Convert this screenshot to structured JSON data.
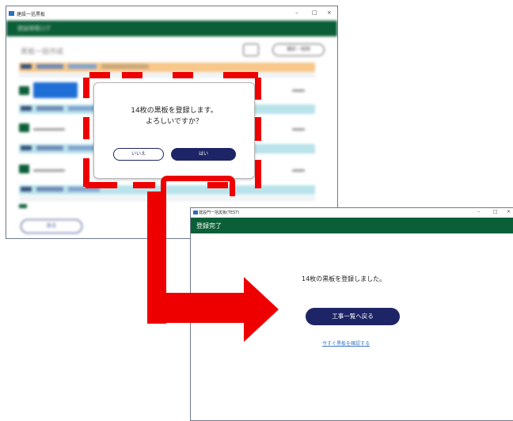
{
  "window1": {
    "title": "建設一括黒板",
    "minimize": "–",
    "maximize": "□",
    "close": "×",
    "header": "建設現場ログ",
    "page_title": "黒板一括作成",
    "action_label": "選択・削除",
    "bottom_button": "戻る"
  },
  "dialog": {
    "message_line1": "14枚の黒板を登録します。",
    "message_line2": "よろしいですか？",
    "cancel_label": "いいえ",
    "ok_label": "はい"
  },
  "window2": {
    "title": "建設門一括黒板(TEST)",
    "minimize": "–",
    "maximize": "□",
    "close": "×",
    "header": "登録完了",
    "message": "14枚の黒板を登録しました。",
    "primary_button": "工事一覧へ戻る",
    "link": "今すぐ黒板を確認する"
  },
  "colors": {
    "green": "#0b5f38",
    "navy": "#1e2566",
    "red": "#ee0000",
    "link": "#3a78c8"
  }
}
